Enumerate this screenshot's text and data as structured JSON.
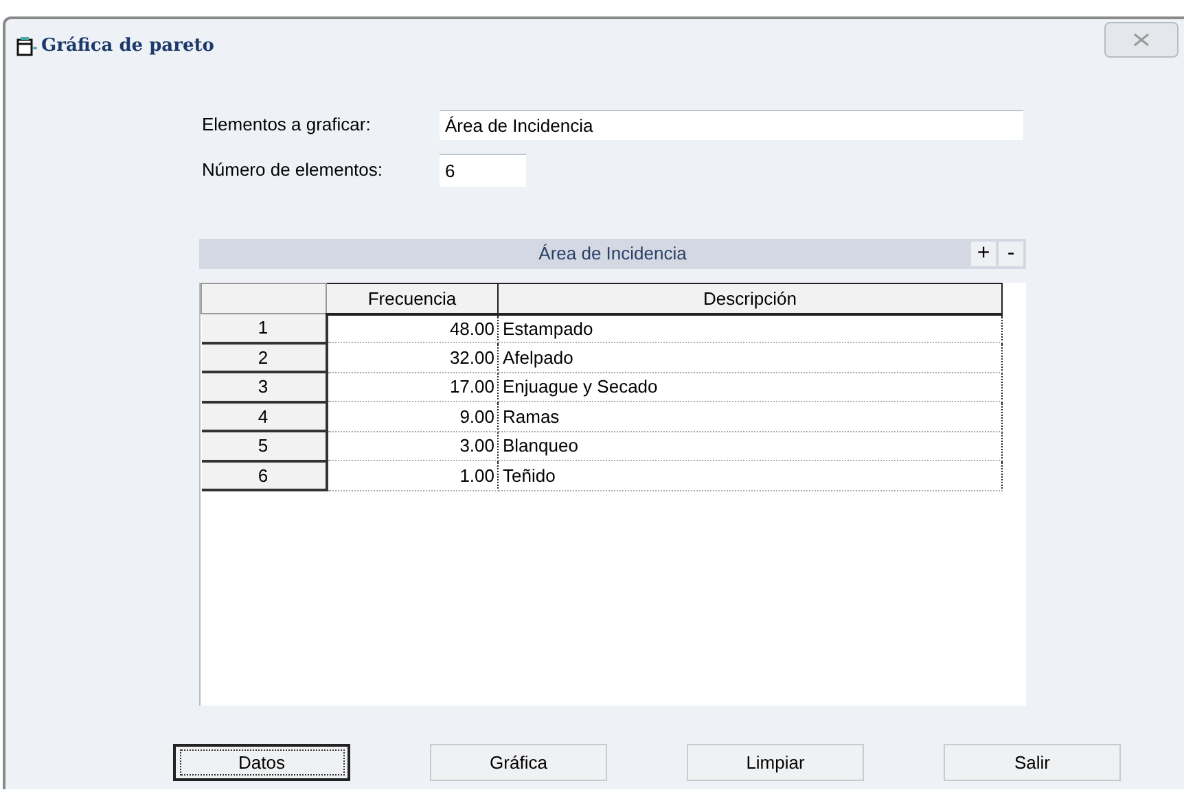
{
  "window": {
    "title": "Gráfica de pareto"
  },
  "form": {
    "elements_label": "Elementos a graficar:",
    "elements_value": "Área de Incidencia",
    "count_label": "Número de elementos:",
    "count_value": "6"
  },
  "grid": {
    "title": "Área de Incidencia",
    "add": "+",
    "remove": "-",
    "columns": [
      "Frecuencia",
      "Descripción"
    ],
    "rows": [
      {
        "index": "1",
        "frecuencia": "48.00",
        "descripcion": "Estampado"
      },
      {
        "index": "2",
        "frecuencia": "32.00",
        "descripcion": "Afelpado"
      },
      {
        "index": "3",
        "frecuencia": "17.00",
        "descripcion": "Enjuague y Secado"
      },
      {
        "index": "4",
        "frecuencia": "9.00",
        "descripcion": "Ramas"
      },
      {
        "index": "5",
        "frecuencia": "3.00",
        "descripcion": "Blanqueo"
      },
      {
        "index": "6",
        "frecuencia": "1.00",
        "descripcion": "Teñido"
      }
    ]
  },
  "buttons": [
    {
      "label": "Datos",
      "focused": true
    },
    {
      "label": "Gráfica",
      "focused": false
    },
    {
      "label": "Limpiar",
      "focused": false
    },
    {
      "label": "Salir",
      "focused": false
    }
  ]
}
